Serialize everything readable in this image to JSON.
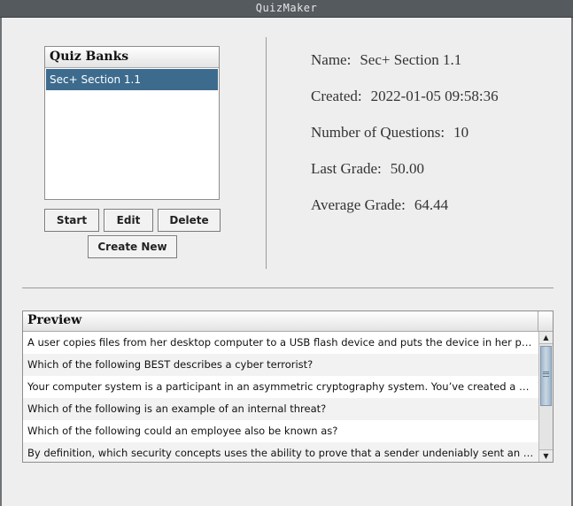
{
  "window": {
    "title": "QuizMaker"
  },
  "quiz_banks": {
    "header": "Quiz Banks",
    "items": [
      "Sec+ Section 1.1"
    ],
    "selected_index": 0
  },
  "buttons": {
    "start": "Start",
    "edit": "Edit",
    "delete": "Delete",
    "create_new": "Create New"
  },
  "details": {
    "name_label": "Name:",
    "name_value": "Sec+ Section 1.1",
    "created_label": "Created:",
    "created_value": "2022-01-05 09:58:36",
    "num_questions_label": "Number of Questions:",
    "num_questions_value": "10",
    "last_grade_label": "Last Grade:",
    "last_grade_value": "50.00",
    "average_grade_label": "Average Grade:",
    "average_grade_value": "64.44"
  },
  "preview": {
    "header": "Preview",
    "rows": [
      "A user copies files from her desktop computer to a USB flash device and puts the device in her pocket. ...",
      "Which of the following BEST describes a cyber terrorist?",
      "Your computer system is a participant in an asymmetric cryptography system. You’ve created a messag...",
      "Which of the following is an example of an internal threat?",
      "Which of the following could an employee also be known as?",
      "By definition, which security concepts uses the ability to prove that a sender undeniably sent an encrypt..."
    ]
  },
  "colors": {
    "selection": "#3d6b8e",
    "titlebar": "#555a5f",
    "background": "#eeeeee"
  }
}
